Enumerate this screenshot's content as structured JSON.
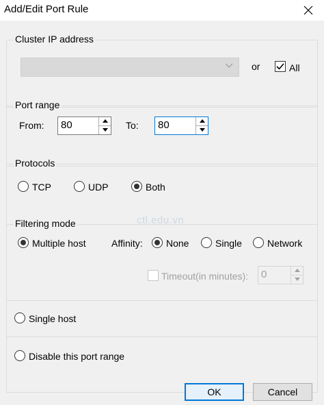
{
  "window": {
    "title": "Add/Edit Port Rule"
  },
  "cluster_ip": {
    "legend": "Cluster IP address",
    "combo_value": "",
    "or_label": "or",
    "all_label": "All",
    "all_checked": true
  },
  "port_range": {
    "legend": "Port range",
    "from_label": "From:",
    "from_value": "80",
    "to_label": "To:",
    "to_value": "80"
  },
  "protocols": {
    "legend": "Protocols",
    "options": [
      {
        "label": "TCP",
        "checked": false
      },
      {
        "label": "UDP",
        "checked": false
      },
      {
        "label": "Both",
        "checked": true
      }
    ]
  },
  "watermark": "ctl.edu.vn",
  "filtering": {
    "legend": "Filtering mode",
    "multiple_host_label": "Multiple host",
    "affinity_label": "Affinity:",
    "affinity_options": [
      {
        "label": "None",
        "checked": true
      },
      {
        "label": "Single",
        "checked": false
      },
      {
        "label": "Network",
        "checked": false
      }
    ],
    "timeout_label": "Timeout(in minutes):",
    "timeout_value": "0",
    "single_host_label": "Single host",
    "disable_label": "Disable this port range"
  },
  "buttons": {
    "ok": "OK",
    "cancel": "Cancel"
  }
}
